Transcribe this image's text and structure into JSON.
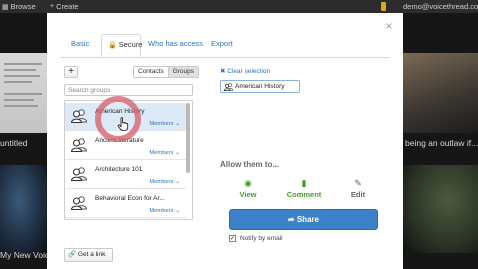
{
  "topbar": {
    "browse_label": "Browse",
    "create_label": "Create",
    "user_email": "demo@voicethread.com"
  },
  "background": {
    "captions": [
      "untitled",
      "being an outlaw if...",
      "My New Voic"
    ]
  },
  "modal": {
    "tabs": [
      {
        "label": "Basic",
        "active": false
      },
      {
        "label": "Secure",
        "active": true
      },
      {
        "label": "Who has access",
        "active": false
      },
      {
        "label": "Export",
        "active": false
      }
    ],
    "add_label": "+",
    "toggle": {
      "contacts": "Contacts",
      "groups": "Groups",
      "selected": "Groups"
    },
    "search_placeholder": "Search groups",
    "groups": [
      {
        "name": "American History",
        "members": "Members",
        "selected": true
      },
      {
        "name": "Ancient literature",
        "members": "Members",
        "selected": false
      },
      {
        "name": "Architecture 101",
        "members": "Members",
        "selected": false
      },
      {
        "name": "Behavioral Econ for Ar...",
        "members": "Members",
        "selected": false
      }
    ],
    "get_link_label": "Get a link",
    "clear_selection": "Clear selection",
    "selected_chip": "American History",
    "allow_label": "Allow them to...",
    "permissions": {
      "view": "View",
      "comment": "Comment",
      "edit": "Edit"
    },
    "share_label": "Share",
    "notify_label": "Notify by email",
    "notify_checked": true
  },
  "colors": {
    "accent": "#2a76c6",
    "share_button": "#3b82c9",
    "permission_on": "#4a9a2e",
    "highlight": "#d6626e",
    "selected_row": "#dceaf7"
  }
}
